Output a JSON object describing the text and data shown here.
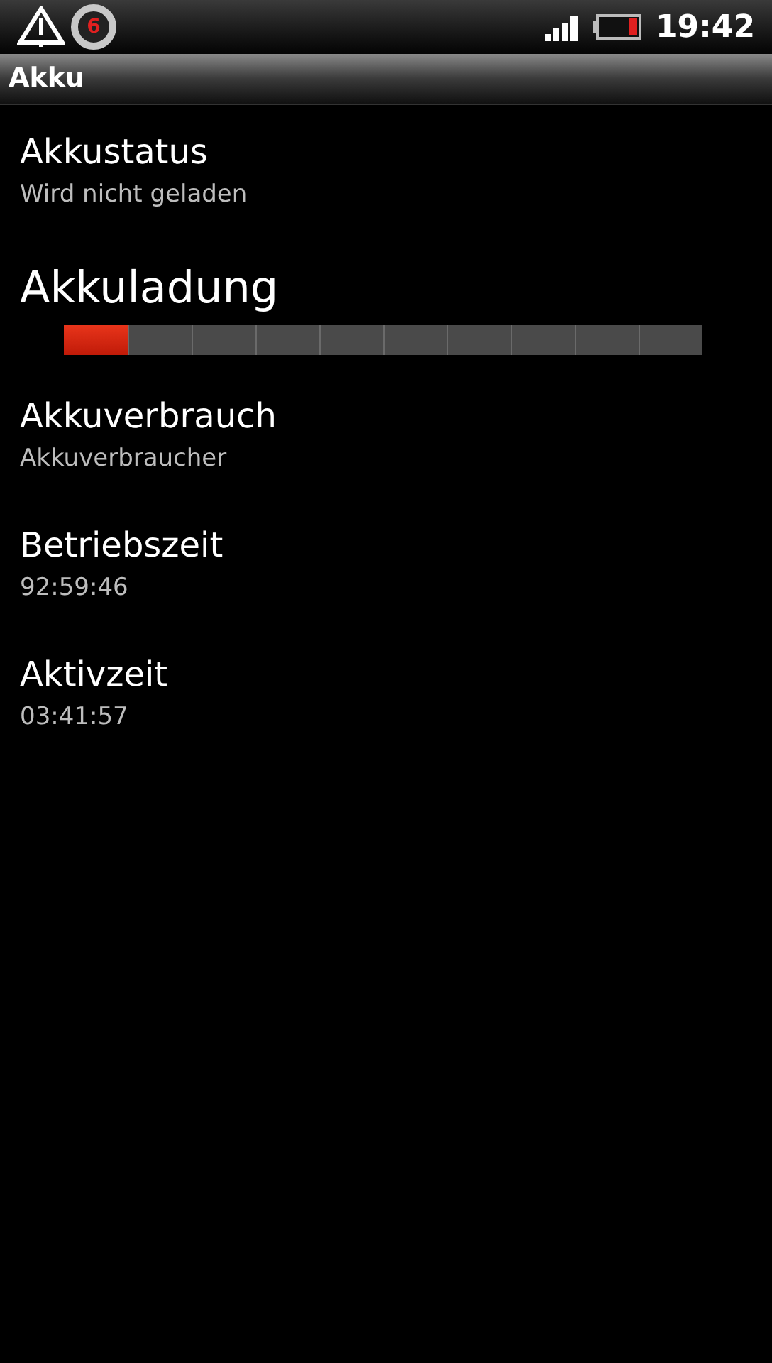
{
  "status_bar": {
    "notification_count": "6",
    "time": "19:42"
  },
  "title_bar": {
    "title": "Akku"
  },
  "items": [
    {
      "kind": "text",
      "title": "Akkustatus",
      "summary": "Wird nicht geladen"
    },
    {
      "kind": "meter",
      "title": "Akkuladung",
      "level": 0.1
    },
    {
      "kind": "text",
      "title": "Akkuverbrauch",
      "summary": "Akkuverbraucher"
    },
    {
      "kind": "text",
      "title": "Betriebszeit",
      "summary": "92:59:46"
    },
    {
      "kind": "text",
      "title": "Aktivzeit",
      "summary": "03:41:57"
    }
  ]
}
